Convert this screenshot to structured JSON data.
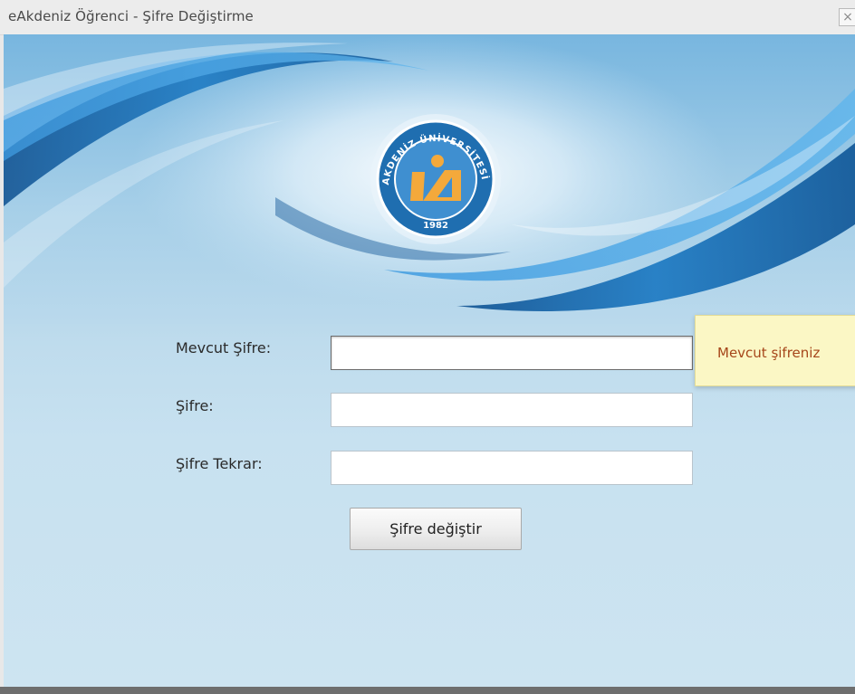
{
  "window": {
    "title": "eAkdeniz Öğrenci - Şifre Değiştirme",
    "close_glyph": "×"
  },
  "logo": {
    "ring_text": "AKDENİZ ÜNİVERSİTESİ",
    "year": "1982",
    "colors": {
      "ring": "#1f6eb0",
      "inner": "#3f8fd0",
      "orange": "#f4a93b"
    }
  },
  "form": {
    "current_password_label": "Mevcut Şifre:",
    "current_password_value": "",
    "new_password_label": "Şifre:",
    "new_password_value": "",
    "repeat_password_label": "Şifre Tekrar:",
    "repeat_password_value": "",
    "submit_label": "Şifre değiştir"
  },
  "tooltip": {
    "text": "Mevcut şifreniz"
  },
  "colors": {
    "tooltip_background": "#fbf7c5",
    "tooltip_text": "#a6461a",
    "background_blue": "#bfdced"
  }
}
